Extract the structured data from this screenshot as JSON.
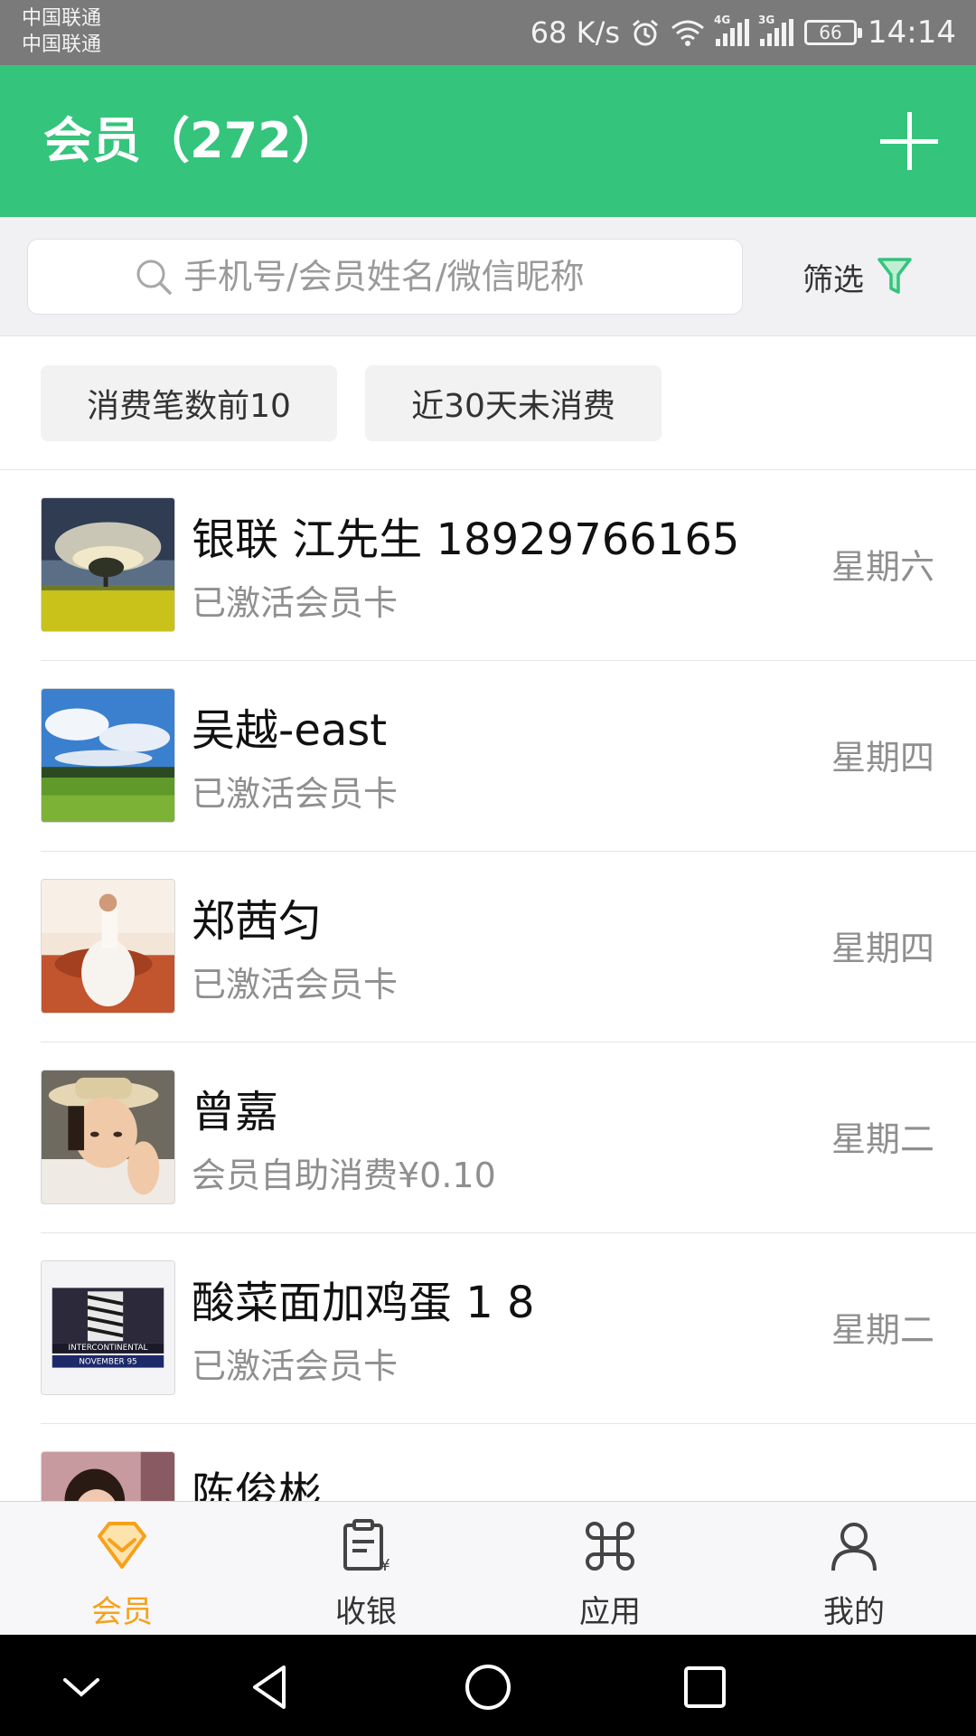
{
  "status_bar": {
    "carrier_1": "中国联通",
    "carrier_2": "中国联通",
    "net_speed": "68 K/s",
    "signal_1_tag": "4G",
    "signal_2_tag": "3G",
    "battery": "66",
    "time": "14:14"
  },
  "header": {
    "title": "会员（272）",
    "bg_color": "#34c47c"
  },
  "search": {
    "placeholder": "手机号/会员姓名/微信昵称",
    "filter_label": "筛选"
  },
  "quick_filters": [
    {
      "label": "消费笔数前10"
    },
    {
      "label": "近30天未消费"
    }
  ],
  "members": [
    {
      "name": "银联 江先生 18929766165",
      "status": "已激活会员卡",
      "day": "星期六"
    },
    {
      "name": "吴越-east",
      "status": "已激活会员卡",
      "day": "星期四"
    },
    {
      "name": "郑茜匀",
      "status": "已激活会员卡",
      "day": "星期四"
    },
    {
      "name": "曾嘉",
      "status": "会员自助消费¥0.10",
      "day": "星期二"
    },
    {
      "name": "酸菜面加鸡蛋 1 8",
      "status": "已激活会员卡",
      "day": "星期二"
    },
    {
      "name": "陈俊彬",
      "status": "",
      "day": ""
    }
  ],
  "avatar_5_caption": {
    "line1": "INTERCONTINENTAL",
    "line2": "NOVEMBER 95"
  },
  "bottom_nav": [
    {
      "label": "会员",
      "icon": "member-diamond-icon",
      "active": true
    },
    {
      "label": "收银",
      "icon": "cashier-receipt-icon",
      "active": false
    },
    {
      "label": "应用",
      "icon": "apps-command-icon",
      "active": false
    },
    {
      "label": "我的",
      "icon": "profile-person-icon",
      "active": false
    }
  ],
  "colors": {
    "accent_orange": "#f6a11b",
    "filter_green": "#34c47c"
  }
}
